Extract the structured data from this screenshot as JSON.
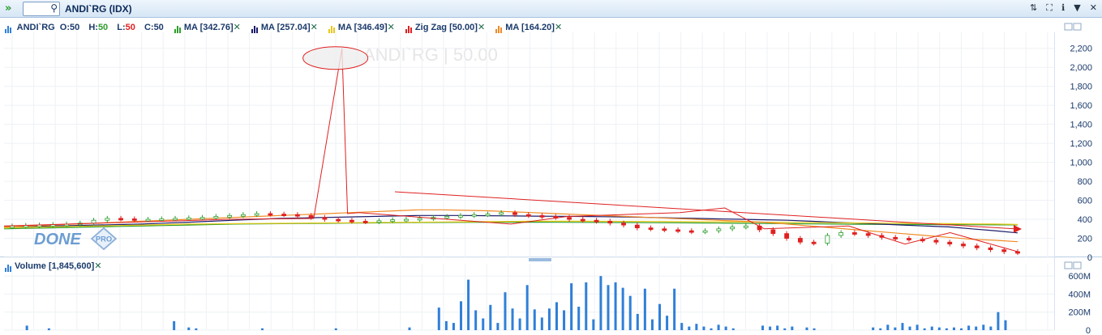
{
  "window": {
    "title": "ANDI`RG (IDX)",
    "search_placeholder": ""
  },
  "ohlc": {
    "symbol": "ANDI`RG",
    "o_label": "O:",
    "o": "50",
    "h_label": "H:",
    "h": "50",
    "l_label": "L:",
    "l": "50",
    "c_label": "C:",
    "c": "50"
  },
  "indicators": [
    {
      "label": "MA [342.76]",
      "color": "#2e9e2e"
    },
    {
      "label": "MA [257.04]",
      "color": "#1b1b6b"
    },
    {
      "label": "MA [346.49]",
      "color": "#e8c81a"
    },
    {
      "label": "Zig Zag [50.00]",
      "color": "#e02020"
    },
    {
      "label": "MA [164.20]",
      "color": "#f08a24"
    }
  ],
  "watermark": "ANDI`RG | 50.00",
  "logo": {
    "text": "DONE",
    "badge": "PRO"
  },
  "volume": {
    "label": "Volume [1,845,600]"
  },
  "price_axis": [
    "2,200",
    "2,000",
    "1,800",
    "1,600",
    "1,400",
    "1,200",
    "1,000",
    "800",
    "600",
    "400",
    "200",
    "0"
  ],
  "volume_axis": [
    "600M",
    "400M",
    "200M",
    "0"
  ],
  "colors": {
    "up": "#2e9e2e",
    "down": "#e02020",
    "volume": "#2f7fd8"
  },
  "chart_data": {
    "type": "line",
    "price": {
      "ylim": [
        0,
        2300
      ],
      "close": [
        330,
        335,
        340,
        345,
        350,
        360,
        390,
        410,
        405,
        400,
        400,
        405,
        410,
        415,
        420,
        430,
        440,
        450,
        460,
        455,
        450,
        440,
        420,
        400,
        390,
        380,
        375,
        385,
        395,
        400,
        410,
        420,
        430,
        440,
        450,
        455,
        470,
        450,
        440,
        430,
        420,
        400,
        390,
        380,
        360,
        340,
        310,
        300,
        290,
        280,
        270,
        280,
        300,
        320,
        330,
        290,
        250,
        200,
        160,
        150,
        230,
        260,
        250,
        230,
        210,
        200,
        190,
        180,
        160,
        140,
        120,
        100,
        80,
        60,
        50
      ],
      "zigzag": [
        [
          0,
          330
        ],
        [
          40,
          400
        ],
        [
          55,
          410
        ],
        [
          60,
          2200
        ],
        [
          61,
          460
        ],
        [
          63,
          470
        ],
        [
          90,
          350
        ],
        [
          100,
          430
        ],
        [
          120,
          470
        ],
        [
          128,
          520
        ],
        [
          135,
          300
        ],
        [
          150,
          330
        ],
        [
          160,
          140
        ],
        [
          168,
          260
        ],
        [
          180,
          60
        ]
      ],
      "ma": [
        {
          "name": "MA [342.76]",
          "color": "#2e9e2e",
          "values": [
            300,
            305,
            310,
            315,
            320,
            325,
            330,
            335,
            340,
            345,
            350,
            352,
            354,
            356,
            358,
            360,
            362,
            364,
            366,
            367,
            368,
            369,
            370,
            370,
            369,
            368,
            367,
            366,
            365,
            364,
            362,
            360,
            358,
            356,
            354,
            352,
            350,
            348,
            347,
            346,
            345,
            344,
            343,
            342,
            342
          ]
        },
        {
          "name": "MA [257.04]",
          "color": "#1b1b6b",
          "values": [
            320,
            325,
            330,
            335,
            340,
            345,
            350,
            360,
            370,
            380,
            390,
            400,
            410,
            415,
            420,
            425,
            430,
            435,
            440,
            440,
            440,
            438,
            436,
            434,
            432,
            430,
            428,
            425,
            420,
            415,
            410,
            405,
            400,
            395,
            390,
            380,
            370,
            360,
            350,
            340,
            330,
            320,
            300,
            280,
            257
          ]
        },
        {
          "name": "MA [346.49]",
          "color": "#e8c81a",
          "values": [
            310,
            315,
            320,
            325,
            330,
            335,
            340,
            345,
            350,
            352,
            354,
            356,
            358,
            360,
            362,
            364,
            366,
            368,
            370,
            372,
            374,
            376,
            378,
            380,
            380,
            380,
            379,
            378,
            377,
            376,
            375,
            374,
            372,
            370,
            368,
            366,
            364,
            362,
            360,
            358,
            356,
            354,
            352,
            350,
            346
          ]
        },
        {
          "name": "MA [164.20]",
          "color": "#f08a24",
          "values": [
            320,
            330,
            340,
            350,
            360,
            370,
            380,
            390,
            400,
            410,
            420,
            430,
            440,
            450,
            460,
            470,
            480,
            490,
            500,
            500,
            495,
            490,
            480,
            470,
            460,
            450,
            440,
            430,
            420,
            410,
            400,
            390,
            380,
            370,
            350,
            330,
            310,
            290,
            270,
            250,
            230,
            210,
            190,
            180,
            164
          ]
        }
      ]
    },
    "volume": {
      "ylim": [
        0,
        700
      ],
      "values": [
        0,
        0,
        50,
        0,
        0,
        20,
        0,
        0,
        0,
        0,
        0,
        0,
        0,
        0,
        0,
        0,
        0,
        0,
        0,
        0,
        0,
        0,
        100,
        0,
        30,
        20,
        0,
        0,
        0,
        0,
        0,
        0,
        0,
        0,
        20,
        0,
        0,
        0,
        0,
        0,
        0,
        0,
        0,
        0,
        20,
        0,
        0,
        0,
        0,
        0,
        0,
        0,
        0,
        0,
        30,
        0,
        0,
        0,
        250,
        100,
        80,
        320,
        560,
        220,
        130,
        280,
        80,
        420,
        240,
        130,
        500,
        230,
        140,
        240,
        310,
        220,
        520,
        260,
        530,
        120,
        600,
        500,
        530,
        470,
        380,
        180,
        460,
        120,
        290,
        160,
        460,
        80,
        40,
        70,
        40,
        20,
        60,
        40,
        20,
        0,
        0,
        0,
        50,
        40,
        50,
        20,
        40,
        0,
        30,
        20,
        0,
        0,
        0,
        0,
        0,
        0,
        0,
        30,
        20,
        60,
        30,
        80,
        40,
        60,
        20,
        40,
        30,
        20,
        30,
        20,
        50,
        40,
        60,
        40,
        200,
        110
      ]
    }
  }
}
